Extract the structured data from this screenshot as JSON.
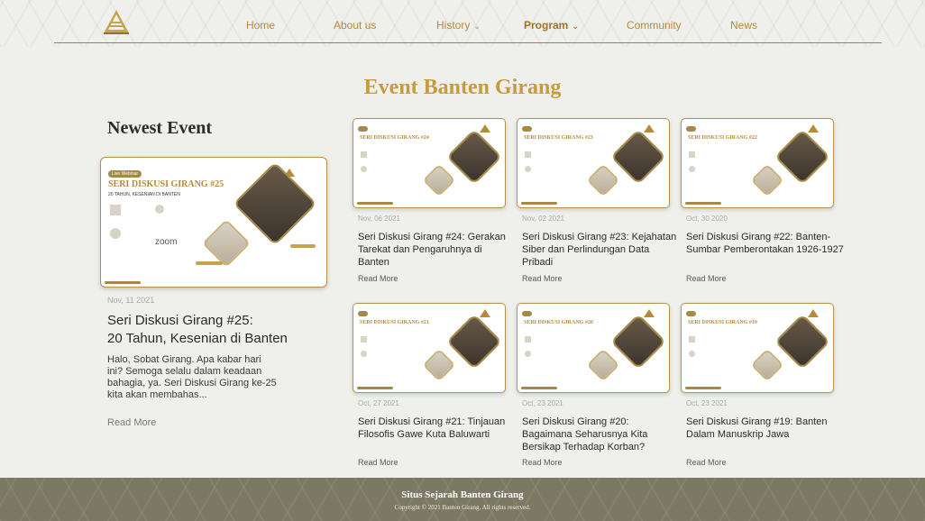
{
  "nav": {
    "items": [
      {
        "label": "Home"
      },
      {
        "label": "About us"
      },
      {
        "label": "History",
        "dropdown": true
      },
      {
        "label": "Program",
        "dropdown": true,
        "active": true
      },
      {
        "label": "Community"
      },
      {
        "label": "News"
      }
    ],
    "caret": "⌄"
  },
  "page": {
    "title": "Event Banten Girang",
    "newest_heading": "Newest Event"
  },
  "featured": {
    "poster_tag": "Live Webinar",
    "poster_title": "SERI DISKUSI GIRANG #25",
    "poster_subtitle": "20 TAHUN, KESENIAN DI BANTEN",
    "poster_zoom": "zoom",
    "date": "Nov, 11 2021",
    "heading_line1": "Seri Diskusi Girang #25:",
    "heading_line2": "20 Tahun, Kesenian di Banten",
    "description": "Halo, Sobat Girang. Apa kabar hari ini? Semoga selalu dalam keadaan bahagia, ya. Seri Diskusi Girang ke-25 kita akan membahas...",
    "read_more": "Read More"
  },
  "events": [
    {
      "poster_title": "SERI DISKUSI GIRANG #24",
      "date": "Nov, 06 2021",
      "heading": "Seri Diskusi Girang #24: Gerakan Tarekat dan Pengaruhnya di Banten",
      "read_more": "Read More"
    },
    {
      "poster_title": "SERI DISKUSI GIRANG #23",
      "date": "Nov, 02 2021",
      "heading": "Seri Diskusi Girang #23: Kejahatan Siber dan Perlindungan Data Pribadi",
      "read_more": "Read More"
    },
    {
      "poster_title": "SERI DISKUSI GIRANG #22",
      "date": "Oct, 30 2020",
      "heading": "Seri Diskusi Girang #22: Banten-Sumbar Pemberontakan 1926-1927",
      "read_more": "Read More"
    },
    {
      "poster_title": "SERI DISKUSI GIRANG #21",
      "date": "Oct, 27 2021",
      "heading": "Seri Diskusi Girang #21: Tinjauan Filosofis Gawe Kuta Baluwarti",
      "read_more": "Read More"
    },
    {
      "poster_title": "SERI DISKUSI GIRANG #20",
      "date": "Oct, 23 2021",
      "heading": "Seri Diskusi Girang #20: Bagaimana Seharusnya Kita Bersikap Terhadap Korban?",
      "read_more": "Read More"
    },
    {
      "poster_title": "SERI DISKUSI GIRANG #19",
      "date": "Oct, 23 2021",
      "heading": "Seri Diskusi Girang #19: Banten Dalam Manuskrip Jawa",
      "read_more": "Read More"
    }
  ],
  "footer": {
    "title": "Situs Sejarah Banten Girang",
    "copyright": "Copyright © 2021 Banten Girang. All rights reserved."
  },
  "colors": {
    "accent_gold": "#c89a3f",
    "footer_bg": "#7b7863",
    "page_bg": "#efefec"
  }
}
